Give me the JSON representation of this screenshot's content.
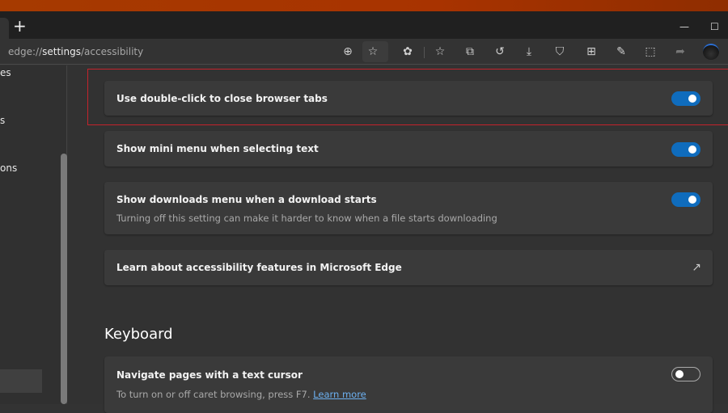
{
  "window": {
    "new_tab": "+",
    "minimize": "—",
    "maximize": "☐"
  },
  "address": {
    "prefix": "edge://",
    "bold": "settings",
    "suffix": "/accessibility"
  },
  "toolbar": {
    "icons": [
      "zoom-icon",
      "favorite-add-icon",
      "extensions-icon",
      "favorites-icon",
      "collections-icon",
      "history-icon",
      "downloads-icon",
      "browser-essentials-icon",
      "apps-icon",
      "web-capture-icon",
      "screenshot-icon",
      "share-icon",
      "profile-avatar"
    ]
  },
  "sidebar": {
    "items": [
      "es",
      "s",
      "ons"
    ]
  },
  "settings": [
    {
      "title": "Use double-click to close browser tabs",
      "on": true
    },
    {
      "title": "Show mini menu when selecting text",
      "on": true
    },
    {
      "title": "Show downloads menu when a download starts",
      "desc": "Turning off this setting can make it harder to know when a file starts downloading",
      "on": true
    },
    {
      "title": "Learn about accessibility features in Microsoft Edge"
    }
  ],
  "keyboard": {
    "heading": "Keyboard",
    "item": {
      "title": "Navigate pages with a text cursor",
      "desc": "To turn on or off caret browsing, press F7.",
      "link": "Learn more",
      "on": false
    }
  },
  "colors": {
    "accent": "#0f6cbd",
    "highlight": "#c4232c"
  }
}
